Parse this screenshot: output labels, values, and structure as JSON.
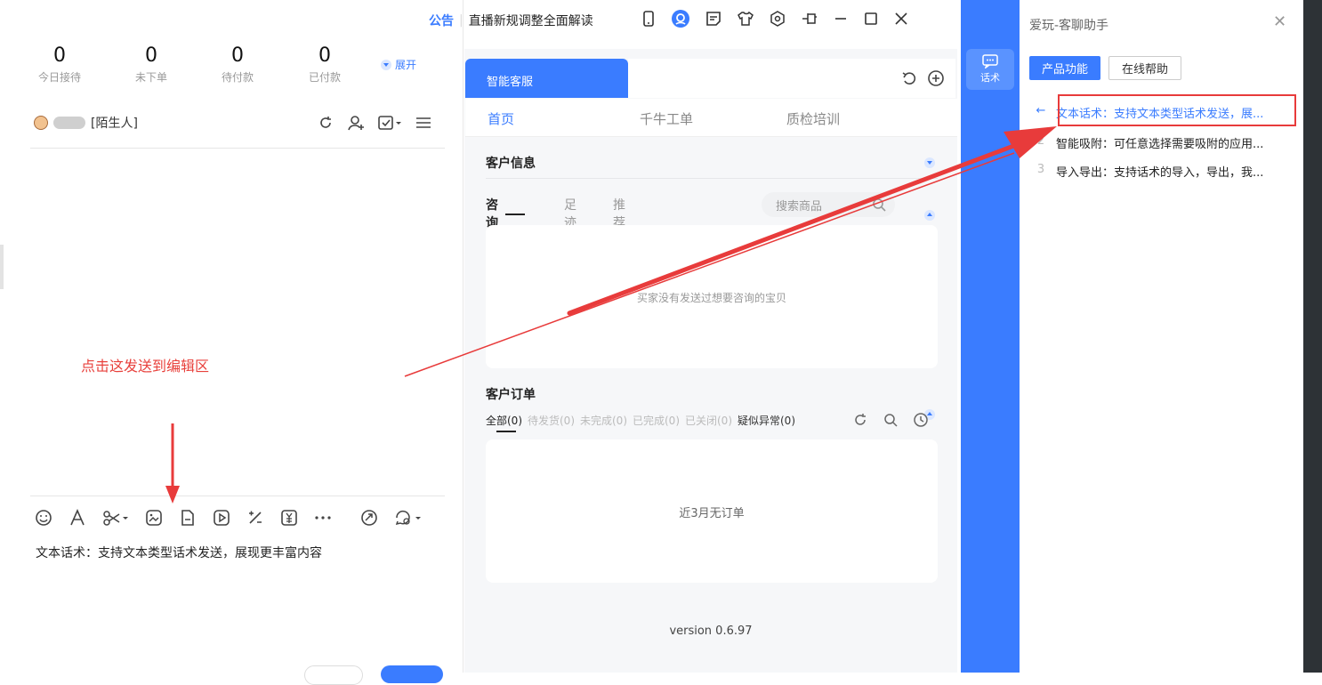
{
  "stats": [
    {
      "value": "0",
      "label": "今日接待"
    },
    {
      "value": "0",
      "label": "未下单"
    },
    {
      "value": "0",
      "label": "待付款"
    },
    {
      "value": "0",
      "label": "已付款"
    }
  ],
  "expand_label": "展开",
  "user": {
    "name": "[陌生人]"
  },
  "notice": {
    "tag": "公告",
    "sep": "|",
    "text": "直播新规调整全面解读"
  },
  "annotation": {
    "note": "点击这发送到编辑区"
  },
  "editor_text": "文本话术：支持文本类型话术发送，展现更丰富内容",
  "middle": {
    "tab_label": "智能客服",
    "subnav": [
      "首页",
      "千牛工单",
      "质检培训"
    ],
    "customer_info_title": "客户信息",
    "consult_tabs": [
      "咨询宝贝",
      "足迹",
      "推荐"
    ],
    "search_placeholder": "搜索商品",
    "no_consult": "买家没有发送过想要咨询的宝贝",
    "orders_title": "客户订单",
    "order_filters": [
      "全部(0)",
      "待发货(0)",
      "未完成(0)",
      "已完成(0)",
      "已关闭(0)",
      "疑似异常(0)"
    ],
    "no_orders": "近3月无订单",
    "version": "version 0.6.97"
  },
  "side_button": {
    "label": "话术"
  },
  "assistant": {
    "title": "爱玩-客聊助手",
    "btn_product": "产品功能",
    "btn_help": "在线帮助",
    "items": [
      {
        "num": "",
        "text": "文本话术：支持文本类型话术发送，展..."
      },
      {
        "num": "2",
        "text": "智能吸附：可任意选择需要吸附的应用..."
      },
      {
        "num": "3",
        "text": "导入导出：支持话术的导入，导出，我..."
      }
    ]
  },
  "colors": {
    "accent": "#3a7cff",
    "annotation": "#e83b3b"
  }
}
